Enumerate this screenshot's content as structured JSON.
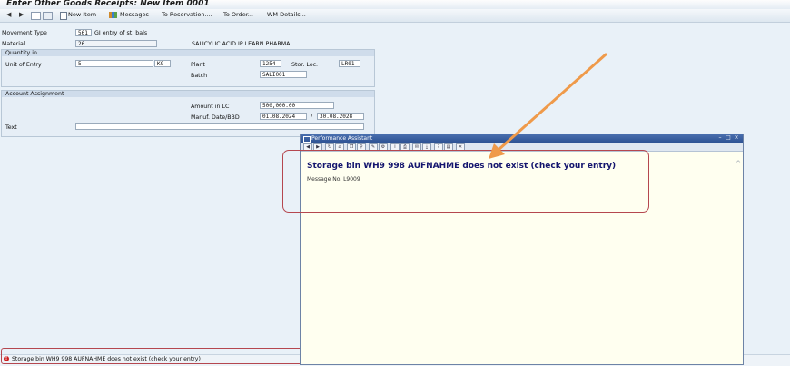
{
  "window": {
    "title": "Enter Other Goods Receipts: New Item 0001"
  },
  "toolbar": {
    "new_item": "New Item",
    "messages": "Messages",
    "to_reservation": "To Reservation....",
    "to_order": "To Order...",
    "wm_details": "WM Details..."
  },
  "form": {
    "movement_type_label": "Movement Type",
    "movement_type_value": "561",
    "movement_type_desc": "GI entry of st. bals",
    "material_label": "Material",
    "material_value": "26",
    "material_desc": "SALICYLIC ACID IP LEARN PHARMA",
    "quantity_group_title": "Quantity in",
    "unit_of_entry_label": "Unit of Entry",
    "unit_of_entry_value": "5",
    "unit_value": "KG",
    "plant_label": "Plant",
    "plant_value": "1254",
    "stor_loc_label": "Stor. Loc.",
    "stor_loc_value": "LR01",
    "batch_label": "Batch",
    "batch_value": "SALI001",
    "account_group_title": "Account Assignment",
    "amount_label": "Amount in LC",
    "amount_value": "500,000.00",
    "manuf_label": "Manuf. Date/BBD",
    "manuf_value": "01.08.2024",
    "date_separator": "/",
    "bbd_value": "30.08.2028",
    "text_label": "Text",
    "text_value": ""
  },
  "popup": {
    "title": "Performance Assistant",
    "heading": "Storage bin WH9 998 AUFNAHME does not exist (check your entry)",
    "message_no": "Message No. L9009"
  },
  "status": {
    "message": "Storage bin WH9 998 AUFNAHME does not exist (check your entry)",
    "icon": "error-icon"
  },
  "colors": {
    "popup_heading": "#14156e",
    "highlight": "#b5474f",
    "arrow": "#ef9a4a",
    "error": "#cc1f1f"
  }
}
